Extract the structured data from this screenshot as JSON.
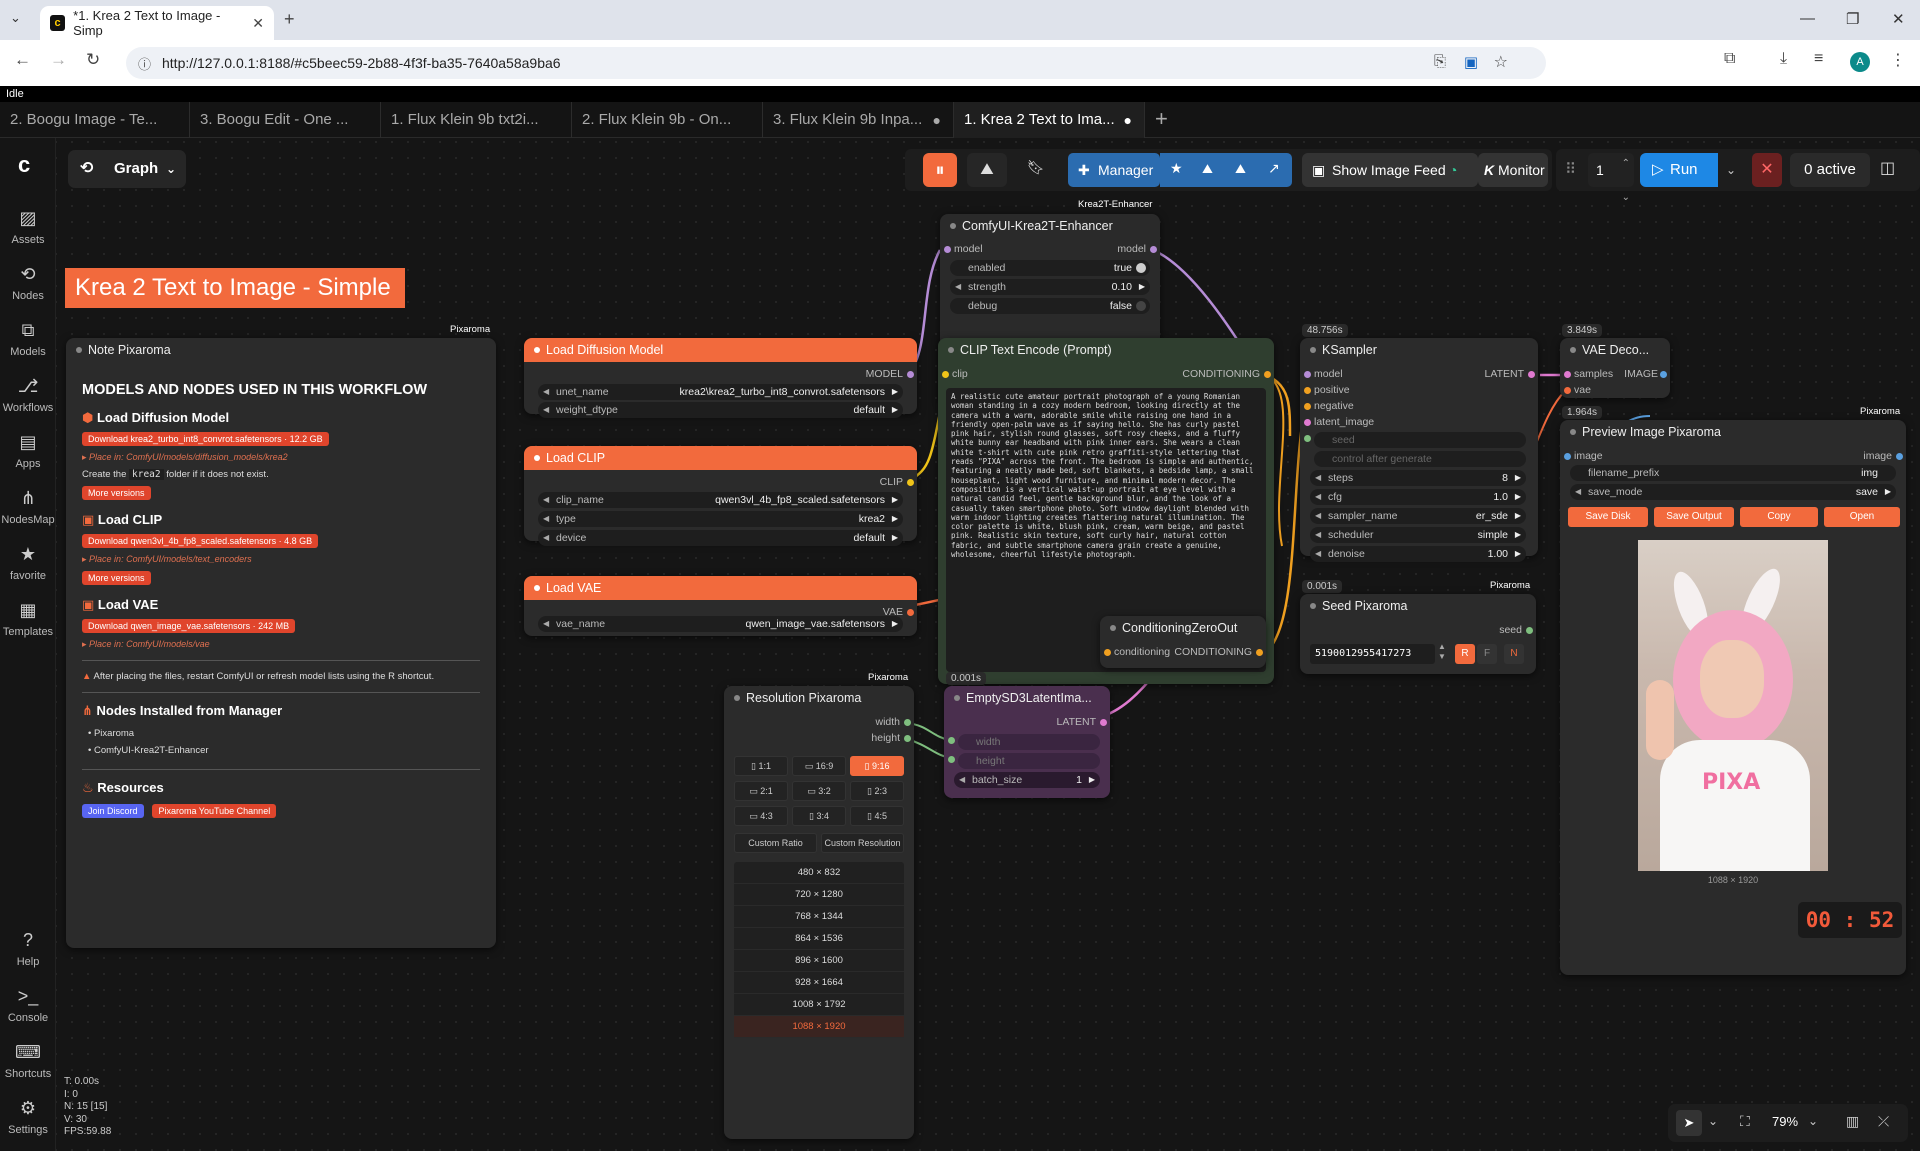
{
  "browser": {
    "tab_title": "*1. Krea 2 Text to Image - Simp",
    "url": "http://127.0.0.1:8188/#c5beec59-2b88-4f3f-ba35-7640a58a9ba6",
    "profile_initial": "A"
  },
  "status": "Idle",
  "workflow_tabs": [
    {
      "label": "2. Boogu Image - Te..."
    },
    {
      "label": "3. Boogu Edit - One ..."
    },
    {
      "label": "1. Flux Klein 9b txt2i..."
    },
    {
      "label": "2. Flux Klein 9b - On..."
    },
    {
      "label": "3. Flux Klein 9b Inpa..."
    },
    {
      "label": "1. Krea 2 Text to Ima..."
    }
  ],
  "sidebar": [
    {
      "label": "Assets"
    },
    {
      "label": "Nodes"
    },
    {
      "label": "Models"
    },
    {
      "label": "Workflows"
    },
    {
      "label": "Apps"
    },
    {
      "label": "NodesMap"
    },
    {
      "label": "favorite"
    },
    {
      "label": "Templates"
    },
    {
      "label": "Help"
    },
    {
      "label": "Console"
    },
    {
      "label": "Shortcuts"
    },
    {
      "label": "Settings"
    }
  ],
  "topbar": {
    "mode": "Graph",
    "manager": "Manager",
    "show_image_feed": "Show Image Feed",
    "monitor": "Monitor",
    "batch_count": "1",
    "run": "Run",
    "active": "0 active"
  },
  "title_banner": "Krea 2 Text to Image - Simple",
  "note": {
    "header": "Note Pixaroma",
    "brand": "Pixaroma",
    "heading": "MODELS AND NODES USED IN THIS WORKFLOW",
    "s1_title": "Load Diffusion Model",
    "s1_download": "Download krea2_turbo_int8_convrot.safetensors  ·  12.2 GB",
    "s1_place": "Place in: ComfyUI/models/diffusion_models/krea2",
    "s1_create_a": "Create the",
    "s1_create_code": "krea2",
    "s1_create_b": "folder if it does not exist.",
    "s1_more": "More versions",
    "s2_title": "Load CLIP",
    "s2_download": "Download qwen3vl_4b_fp8_scaled.safetensors  ·  4.8 GB",
    "s2_place": "Place in: ComfyUI/models/text_encoders",
    "s2_more": "More versions",
    "s3_title": "Load VAE",
    "s3_download": "Download qwen_image_vae.safetensors  ·  242 MB",
    "s3_place": "Place in: ComfyUI/models/vae",
    "warning": "After placing the files, restart ComfyUI or refresh model lists using the R shortcut.",
    "s4_title": "Nodes Installed from Manager",
    "s4_items": [
      "Pixaroma",
      "ComfyUI-Krea2T-Enhancer"
    ],
    "s5_title": "Resources",
    "discord": "Join Discord",
    "youtube": "Pixaroma YouTube Channel"
  },
  "load_diffusion": {
    "title": "Load Diffusion Model",
    "out": "MODEL",
    "unet_name_label": "unet_name",
    "unet_name": "krea2\\krea2_turbo_int8_convrot.safetensors",
    "weight_label": "weight_dtype",
    "weight": "default"
  },
  "load_clip": {
    "title": "Load CLIP",
    "out": "CLIP",
    "clip_name_label": "clip_name",
    "clip_name": "qwen3vl_4b_fp8_scaled.safetensors",
    "type_label": "type",
    "type": "krea2",
    "device_label": "device",
    "device": "default"
  },
  "load_vae": {
    "title": "Load VAE",
    "out": "VAE",
    "vae_name_label": "vae_name",
    "vae_name": "qwen_image_vae.safetensors"
  },
  "enhancer": {
    "tag": "Krea2T-Enhancer",
    "title": "ComfyUI-Krea2T-Enhancer",
    "in": "model",
    "out": "model",
    "enabled_label": "enabled",
    "enabled": "true",
    "strength_label": "strength",
    "strength": "0.10",
    "debug_label": "debug",
    "debug": "false"
  },
  "clip_encode": {
    "title": "CLIP Text Encode (Prompt)",
    "in": "clip",
    "out": "CONDITIONING",
    "prompt": "A realistic cute amateur portrait photograph of a young Romanian woman standing in a cozy modern bedroom, looking directly at the camera with a warm, adorable smile while raising one hand in a friendly open-palm wave as if saying hello. She has curly pastel pink hair, stylish round glasses, soft rosy cheeks, and a fluffy white bunny ear headband with pink inner ears. She wears a clean white t-shirt with cute pink retro graffiti-style lettering that reads \"PIXA\" across the front. The bedroom is simple and authentic, featuring a neatly made bed, soft blankets, a bedside lamp, a small houseplant, light wood furniture, and minimal modern decor. The composition is a vertical waist-up portrait at eye level with a natural candid feel, gentle background blur, and the look of a casually taken smartphone photo. Soft window daylight blended with warm indoor lighting creates flattering natural illumination. The color palette is white, blush pink, cream, warm beige, and pastel pink. Realistic skin texture, soft curly hair, natural cotton fabric, and subtle smartphone camera grain create a genuine, wholesome, cheerful lifestyle photograph."
  },
  "ksampler": {
    "time": "48.756s",
    "title": "KSampler",
    "in_model": "model",
    "in_positive": "positive",
    "in_negative": "negative",
    "in_latent": "latent_image",
    "out": "LATENT",
    "seed": "seed",
    "control": "control after generate",
    "steps_label": "steps",
    "steps": "8",
    "cfg_label": "cfg",
    "cfg": "1.0",
    "sampler_label": "sampler_name",
    "sampler": "er_sde",
    "scheduler_label": "scheduler",
    "scheduler": "simple",
    "denoise_label": "denoise",
    "denoise": "1.00"
  },
  "vae_decode": {
    "time": "3.849s",
    "title": "VAE Deco...",
    "in_samples": "samples",
    "in_vae": "vae",
    "out": "IMAGE"
  },
  "preview": {
    "time": "1.964s",
    "brand": "Pixaroma",
    "title": "Preview Image Pixaroma",
    "in": "image",
    "out": "image",
    "prefix_label": "filename_prefix",
    "prefix": "img",
    "save_mode_label": "save_mode",
    "save_mode": "save",
    "b_save_disk": "Save Disk",
    "b_save_output": "Save Output",
    "b_copy": "Copy",
    "b_open": "Open",
    "dims": "1088 × 1920",
    "shirt_text": "PIXA"
  },
  "seed_node": {
    "time": "0.001s",
    "brand": "Pixaroma",
    "title": "Seed Pixaroma",
    "out": "seed",
    "value": "5190012955417273",
    "r": "R",
    "f": "F",
    "n": "N"
  },
  "cond_zero": {
    "title": "ConditioningZeroOut",
    "in": "conditioning",
    "out": "CONDITIONING"
  },
  "latent": {
    "time": "0.001s",
    "title": "EmptySD3LatentIma...",
    "out": "LATENT",
    "width": "width",
    "height": "height",
    "batch_label": "batch_size",
    "batch": "1"
  },
  "resolution": {
    "brand": "Pixaroma",
    "title": "Resolution Pixaroma",
    "out_w": "width",
    "out_h": "height",
    "ratios": [
      "1:1",
      "16:9",
      "9:16",
      "2:1",
      "3:2",
      "2:3",
      "4:3",
      "3:4",
      "4:5"
    ],
    "custom_ratio": "Custom Ratio",
    "custom_res": "Custom Resolution",
    "list": [
      "480 × 832",
      "720 × 1280",
      "768 × 1344",
      "864 × 1536",
      "896 × 1600",
      "928 × 1664",
      "1008 × 1792",
      "1088 × 1920"
    ],
    "selected": "1088 × 1920"
  },
  "timer": {
    "m": "00",
    "s": "52"
  },
  "stats": [
    "T: 0.00s",
    "I: 0",
    "N: 15 [15]",
    "V: 30",
    "FPS:59.88"
  ],
  "zoom": "79%",
  "colors": {
    "accent": "#f26a3d",
    "run": "#1e88e5",
    "manager": "#2b6cb0",
    "latent": "#4a2f4e",
    "clip": "#2f3e2f"
  }
}
